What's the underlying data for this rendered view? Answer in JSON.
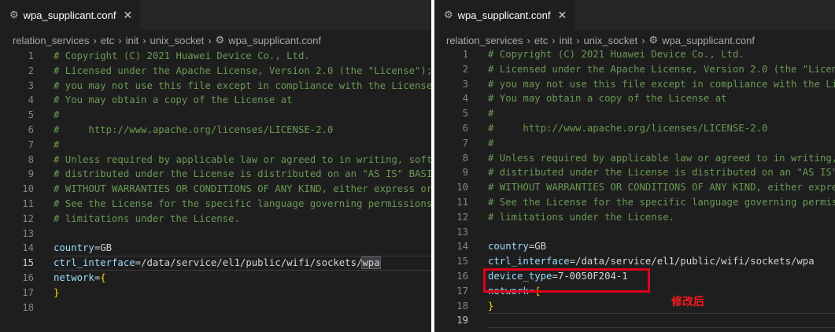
{
  "left": {
    "tab_title": "wpa_supplicant.conf",
    "breadcrumb": [
      "relation_services",
      "etc",
      "init",
      "unix_socket",
      "wpa_supplicant.conf"
    ],
    "lines": [
      {
        "n": "1",
        "t": "# Copyright (C) 2021 Huawei Device Co., Ltd."
      },
      {
        "n": "2",
        "t": "# Licensed under the Apache License, Version 2.0 (the \"License\");"
      },
      {
        "n": "3",
        "t": "# you may not use this file except in compliance with the License."
      },
      {
        "n": "4",
        "t": "# You may obtain a copy of the License at"
      },
      {
        "n": "5",
        "t": "#"
      },
      {
        "n": "6",
        "t": "#     http://www.apache.org/licenses/LICENSE-2.0"
      },
      {
        "n": "7",
        "t": "#"
      },
      {
        "n": "8",
        "t": "# Unless required by applicable law or agreed to in writing, software"
      },
      {
        "n": "9",
        "t": "# distributed under the License is distributed on an \"AS IS\" BASIS,"
      },
      {
        "n": "10",
        "t": "# WITHOUT WARRANTIES OR CONDITIONS OF ANY KIND, either express or implied."
      },
      {
        "n": "11",
        "t": "# See the License for the specific language governing permissions and"
      },
      {
        "n": "12",
        "t": "# limitations under the License."
      },
      {
        "n": "13",
        "t": ""
      },
      {
        "n": "14",
        "t": "country=GB"
      },
      {
        "n": "15",
        "t": "ctrl_interface=/data/service/el1/public/wifi/sockets/wpa"
      },
      {
        "n": "16",
        "t": "network={"
      },
      {
        "n": "17",
        "t": "}"
      },
      {
        "n": "18",
        "t": ""
      }
    ]
  },
  "right": {
    "tab_title": "wpa_supplicant.conf",
    "breadcrumb": [
      "relation_services",
      "etc",
      "init",
      "unix_socket",
      "wpa_supplicant.conf"
    ],
    "lines": [
      {
        "n": "1",
        "t": "# Copyright (C) 2021 Huawei Device Co., Ltd."
      },
      {
        "n": "2",
        "t": "# Licensed under the Apache License, Version 2.0 (the \"License\");"
      },
      {
        "n": "3",
        "t": "# you may not use this file except in compliance with the License."
      },
      {
        "n": "4",
        "t": "# You may obtain a copy of the License at"
      },
      {
        "n": "5",
        "t": "#"
      },
      {
        "n": "6",
        "t": "#     http://www.apache.org/licenses/LICENSE-2.0"
      },
      {
        "n": "7",
        "t": "#"
      },
      {
        "n": "8",
        "t": "# Unless required by applicable law or agreed to in writing, software"
      },
      {
        "n": "9",
        "t": "# distributed under the License is distributed on an \"AS IS\" BASIS,"
      },
      {
        "n": "10",
        "t": "# WITHOUT WARRANTIES OR CONDITIONS OF ANY KIND, either express or implied."
      },
      {
        "n": "11",
        "t": "# See the License for the specific language governing permissions and"
      },
      {
        "n": "12",
        "t": "# limitations under the License."
      },
      {
        "n": "13",
        "t": ""
      },
      {
        "n": "14",
        "t": "country=GB"
      },
      {
        "n": "15",
        "t": "ctrl_interface=/data/service/el1/public/wifi/sockets/wpa"
      },
      {
        "n": "16",
        "t": "device_type=7-0050F204-1"
      },
      {
        "n": "17",
        "t": "network={"
      },
      {
        "n": "18",
        "t": "}"
      },
      {
        "n": "19",
        "t": ""
      }
    ]
  },
  "annotation": "修改后",
  "colors": {
    "editor_bg": "#1e1e1e",
    "comment": "#6a9955",
    "key": "#9cdcfe",
    "bracket": "#ffd700",
    "highlight": "#e0001a"
  },
  "icons": {
    "tab": "gear-icon",
    "close": "close-icon",
    "breadcrumb_sep": "chevron-right-icon"
  }
}
